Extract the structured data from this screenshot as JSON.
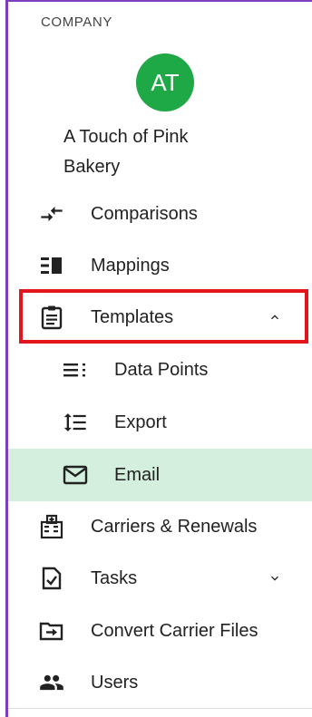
{
  "company": {
    "section_label": "COMPANY",
    "avatar_initials": "AT",
    "name": "A Touch of Pink Bakery"
  },
  "nav": {
    "comparisons": {
      "label": "Comparisons",
      "icon": "compare-arrows-icon"
    },
    "mappings": {
      "label": "Mappings",
      "icon": "mappings-icon"
    },
    "templates": {
      "label": "Templates",
      "icon": "clipboard-icon",
      "expanded": true
    },
    "data_points": {
      "label": "Data Points",
      "icon": "list-icon"
    },
    "export": {
      "label": "Export",
      "icon": "format-line-spacing-icon"
    },
    "email": {
      "label": "Email",
      "icon": "envelope-icon",
      "selected": true
    },
    "carriers": {
      "label": "Carriers & Renewals",
      "icon": "medical-building-icon"
    },
    "tasks": {
      "label": "Tasks",
      "icon": "task-check-icon",
      "expanded": false
    },
    "convert": {
      "label": "Convert Carrier Files",
      "icon": "file-import-icon"
    },
    "users": {
      "label": "Users",
      "icon": "people-icon"
    }
  },
  "colors": {
    "avatar": "#1fa846",
    "active_bg": "#d4efdd",
    "highlight_border": "#e0161c",
    "frame": "#7b3fbf"
  }
}
